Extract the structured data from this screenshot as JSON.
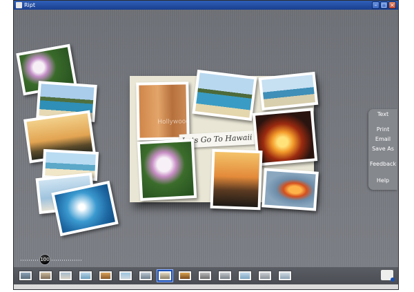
{
  "window": {
    "title": "Ript"
  },
  "collage": {
    "caption": "Lets Go To Hawaii",
    "watermark": "Hollywood"
  },
  "side_menu": {
    "items": [
      "Text",
      "Print",
      "Email",
      "Save As",
      "Feedback",
      "Help"
    ]
  },
  "zoom": {
    "value": "100"
  },
  "thumbnails": {
    "count": 14,
    "active_index": 7
  },
  "icons": [
    "app-icon",
    "minimize-icon",
    "maximize-icon",
    "close-icon",
    "zoom-knob-icon",
    "collage-settings-icon"
  ],
  "colors": {
    "title_bar": "#1a3f8f",
    "background": "#76797f",
    "board": "#e9e6d5",
    "side_menu": "#85888d",
    "active_thumb": "#1a4fb0"
  }
}
